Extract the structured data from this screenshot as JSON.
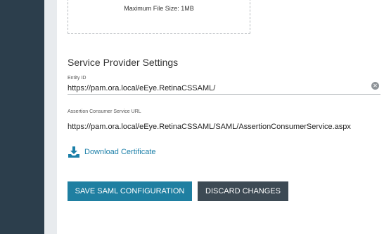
{
  "upload": {
    "max_size_note": "Maximum File Size: 1MB"
  },
  "service_provider": {
    "title": "Service Provider Settings",
    "entity_id": {
      "label": "Entity ID",
      "value": "https://pam.ora.local/eEye.RetinaCSSAML/"
    },
    "acs_url": {
      "label": "Assertion Consumer Service URL",
      "value": "https://pam.ora.local/eEye.RetinaCSSAML/SAML/AssertionConsumerService.aspx"
    },
    "download_certificate": {
      "label": "Download Certificate",
      "icon": "download-icon"
    }
  },
  "actions": {
    "save_label": "SAVE SAML CONFIGURATION",
    "discard_label": "DISCARD CHANGES"
  },
  "colors": {
    "nav": "#2c3e4c",
    "link": "#1b7fa8",
    "primary_button": "#1f7fa1",
    "secondary_button": "#3d4a54"
  }
}
